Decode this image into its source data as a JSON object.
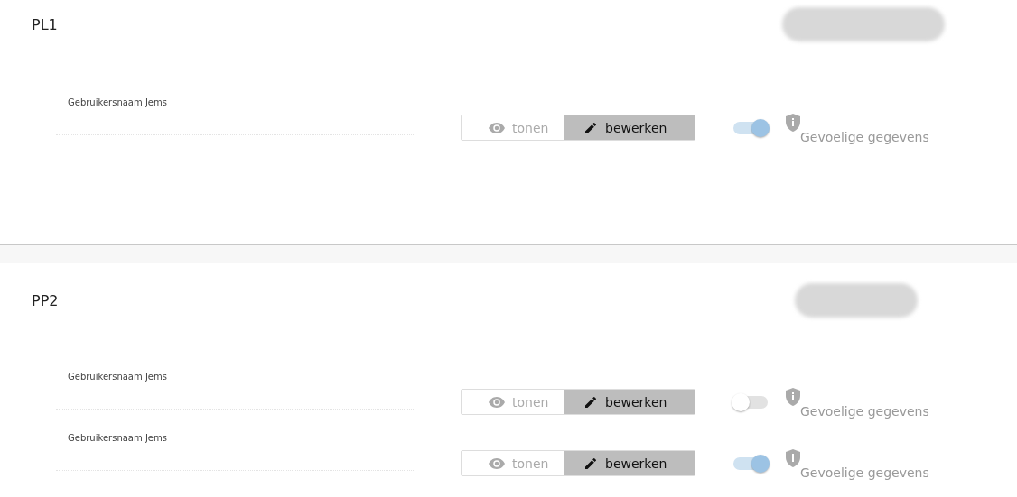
{
  "sections": [
    {
      "title": "PL1",
      "fields": [
        {
          "label": "Gebruikersnaam Jems",
          "modes": [
            {
              "label": "tonen",
              "kind": "view",
              "selected": false
            },
            {
              "label": "bewerken",
              "kind": "edit",
              "selected": true
            }
          ],
          "sensitive_on": true,
          "sensitive_label": "Gevoelige gegevens"
        }
      ]
    },
    {
      "title": "PP2",
      "fields": [
        {
          "label": "Gebruikersnaam Jems",
          "modes": [
            {
              "label": "tonen",
              "kind": "view",
              "selected": false
            },
            {
              "label": "bewerken",
              "kind": "edit",
              "selected": true
            }
          ],
          "sensitive_on": false,
          "sensitive_label": "Gevoelige gegevens"
        },
        {
          "label": "Gebruikersnaam Jems",
          "modes": [
            {
              "label": "tonen",
              "kind": "view",
              "selected": false
            },
            {
              "label": "bewerken",
              "kind": "edit",
              "selected": true
            }
          ],
          "sensitive_on": true,
          "sensitive_label": "Gevoelige gegevens"
        }
      ]
    }
  ]
}
